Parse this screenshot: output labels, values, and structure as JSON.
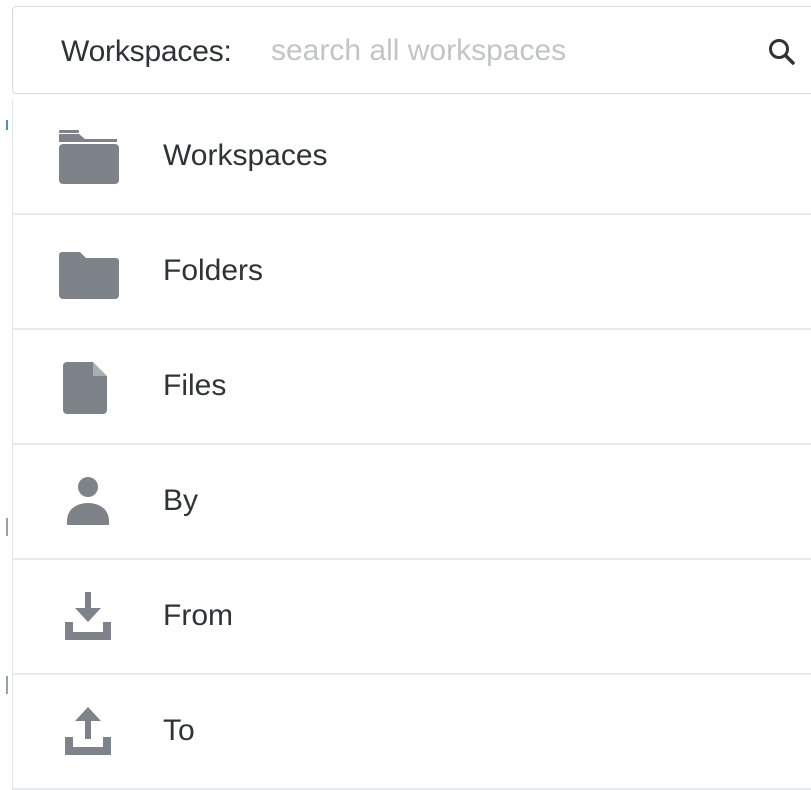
{
  "search": {
    "prefix": "Workspaces:",
    "placeholder": "search all workspaces",
    "icon": "search-icon"
  },
  "menu": {
    "items": [
      {
        "label": "Workspaces",
        "icon": "workspaces-folder-icon"
      },
      {
        "label": "Folders",
        "icon": "folder-icon"
      },
      {
        "label": "Files",
        "icon": "file-icon"
      },
      {
        "label": "By",
        "icon": "person-icon"
      },
      {
        "label": "From",
        "icon": "download-icon"
      },
      {
        "label": "To",
        "icon": "upload-icon"
      }
    ]
  },
  "colors": {
    "icon": "#7d8389",
    "text": "#2f3236",
    "placeholder": "#c2c4c7",
    "border": "#d9dadb"
  }
}
